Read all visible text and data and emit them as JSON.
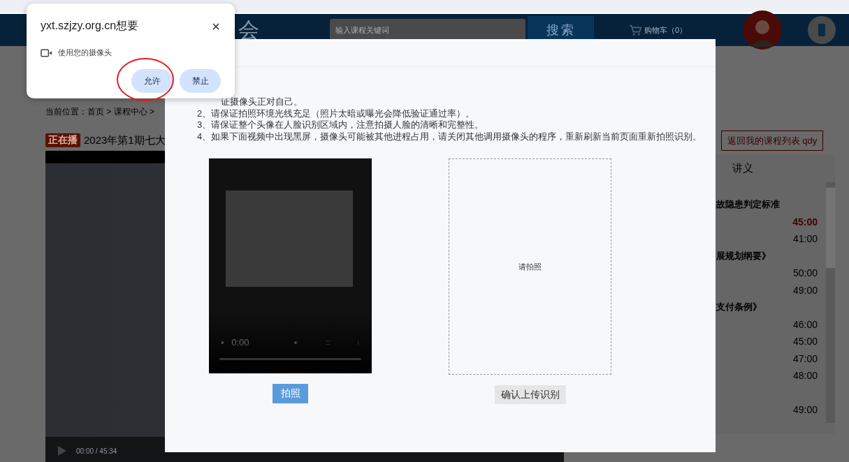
{
  "permission_popup": {
    "title": "yxt.szjzy.org.cn想要",
    "permission": "使用您的摄像头",
    "buttons": [
      {
        "label": "允许",
        "circled": true
      },
      {
        "label": "禁止",
        "circled": false
      }
    ]
  },
  "header": {
    "logo_text": "会",
    "search": {
      "placeholder": "输入课程关键词"
    },
    "search_button": "搜索",
    "cart": "购物车（0）"
  },
  "breadcrumb": "当前位置：首页 > 课程中心 >",
  "course": {
    "badge": "正在播",
    "title": "2023年第1期七大",
    "player_time": "00:00 / 45:34"
  },
  "return_button": "返回我的课程列表 qdy",
  "handout_tab": "讲义",
  "lesson_list": [
    {
      "kind": "heading",
      "text": "故隐患判定标准"
    },
    {
      "kind": "time",
      "text": "45:00",
      "selected": true
    },
    {
      "kind": "time",
      "text": "41:00",
      "selected": false
    },
    {
      "kind": "heading",
      "text": "展规划纲要》"
    },
    {
      "kind": "time",
      "text": "50:00",
      "selected": false
    },
    {
      "kind": "time",
      "text": "49:00",
      "selected": false
    },
    {
      "kind": "heading",
      "text": "支付条例》"
    },
    {
      "kind": "time",
      "text": "46:00",
      "selected": false
    },
    {
      "kind": "time",
      "text": "45:00",
      "selected": false
    },
    {
      "kind": "time",
      "text": "47:00",
      "selected": false
    },
    {
      "kind": "time",
      "text": "48:00",
      "selected": false
    },
    {
      "kind": "blank"
    },
    {
      "kind": "time",
      "text": "49:00",
      "selected": false
    }
  ],
  "modal": {
    "instructions": [
      "证摄像头正对自己。",
      "2、请保证拍照环境光线充足（照片太暗或曝光会降低验证通过率）。",
      "3、请保证整个头像在人脸识别区域内，注意拍摄人脸的清晰和完整性。",
      "4、如果下面视频中出现黑屏，摄像头可能被其他进程占用，请关闭其他调用摄像头的程序，重新刷新当前页面重新拍照识别。"
    ],
    "camera_time": "0:00",
    "camera_seek": {
      "level": 0
    },
    "capture_button": "拍照",
    "photo_placeholder": "请拍照",
    "upload_button": "确认上传识别"
  }
}
